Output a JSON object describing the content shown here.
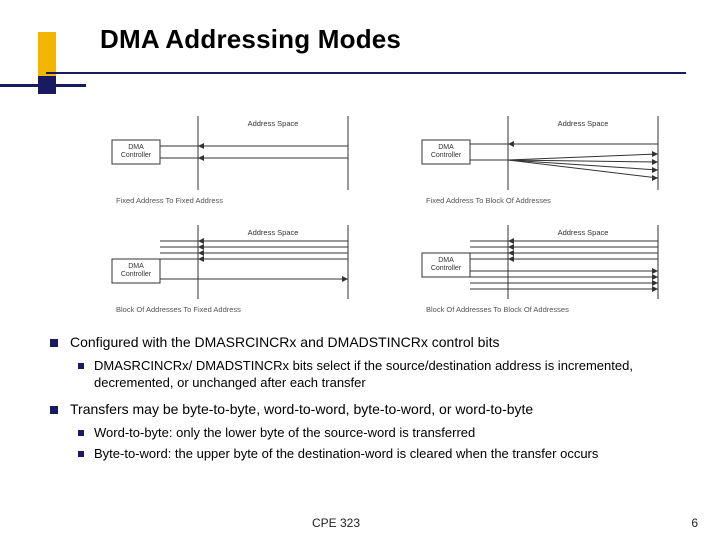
{
  "title": "DMA Addressing Modes",
  "diagrams": {
    "box_dma": "DMA\nController",
    "box_space": "Address Space",
    "captions": {
      "tl": "Fixed Address To Fixed Address",
      "tr": "Fixed Address To Block Of Addresses",
      "bl": "Block Of Addresses To Fixed Address",
      "br": "Block Of Addresses To Block Of Addresses"
    }
  },
  "bullets": {
    "b1": "Configured with the DMASRCINCRx and DMADSTINCRx control bits",
    "b1_sub1": "DMASRCINCRx/ DMADSTINCRx bits select if the source/destination address is incremented, decremented, or unchanged after each transfer",
    "b2": "Transfers may be byte-to-byte, word-to-word, byte-to-word, or word-to-byte",
    "b2_sub1": "Word-to-byte: only the lower byte of the source-word is transferred",
    "b2_sub2": "Byte-to-word: the upper byte of the destination-word is cleared when the transfer occurs"
  },
  "footer": {
    "course": "CPE 323",
    "page": "6"
  }
}
